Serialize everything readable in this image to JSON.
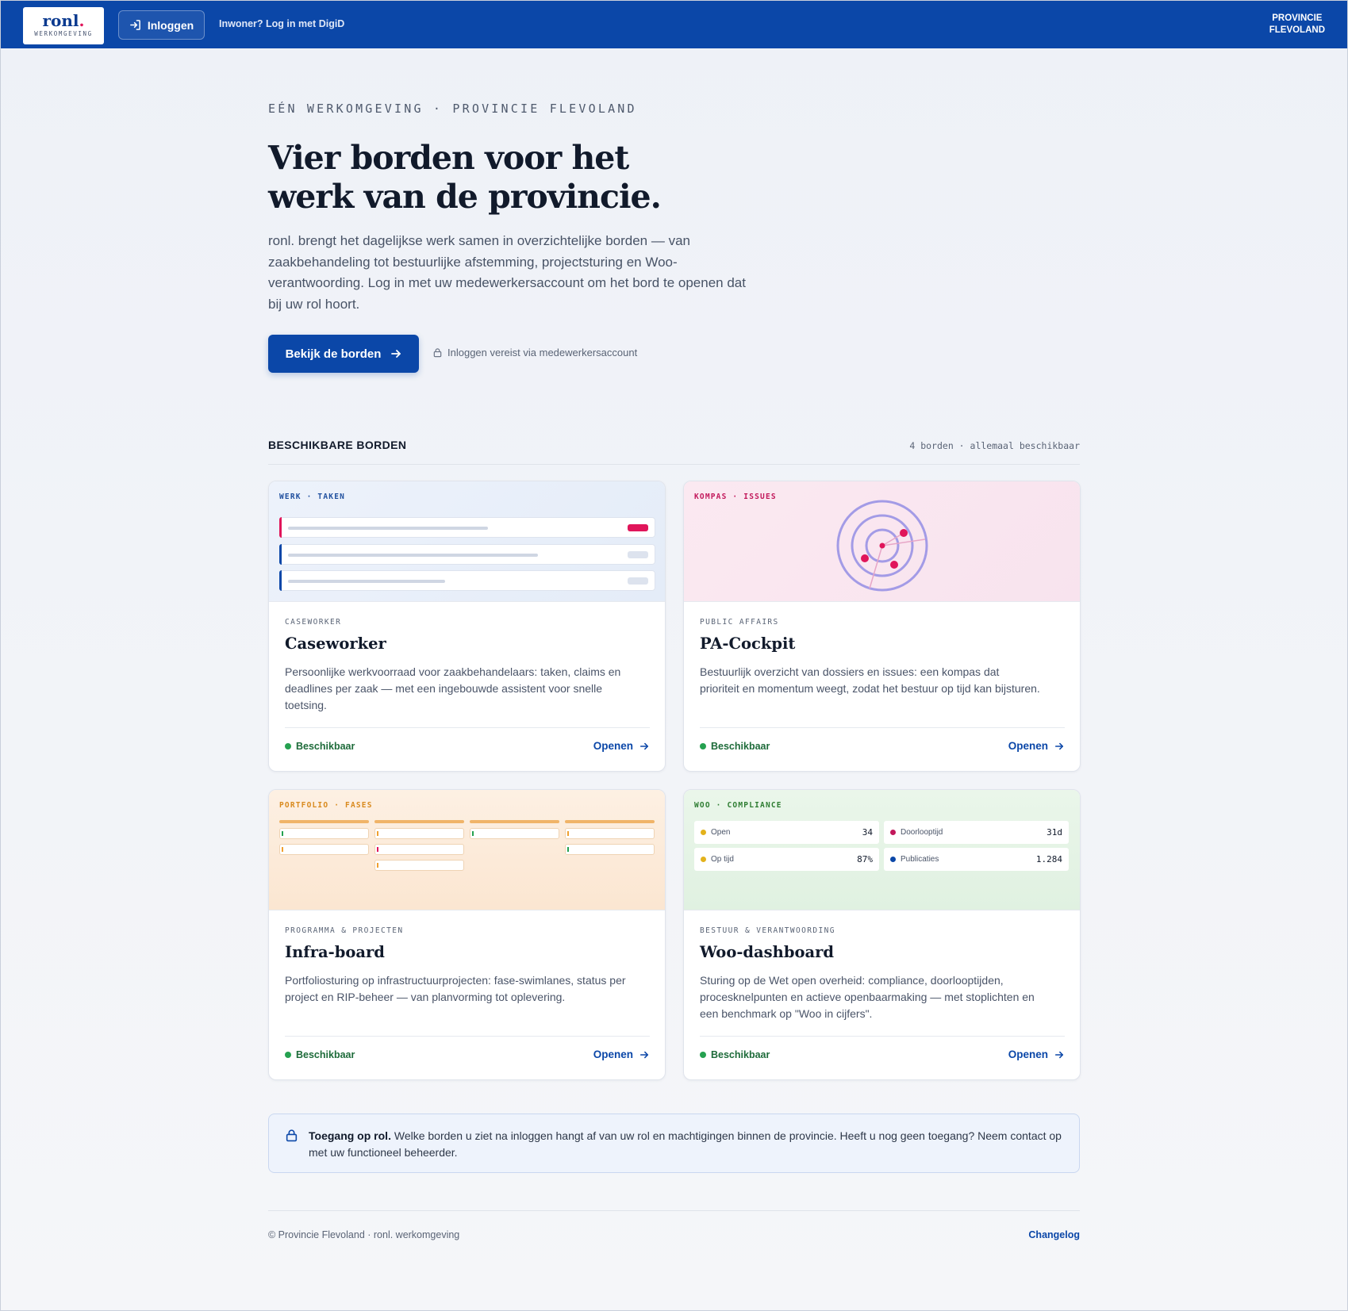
{
  "header": {
    "logo_word": "ronl",
    "logo_dot": ".",
    "logo_sub": "WERKOMGEVING",
    "login_label": "Inloggen",
    "digid_label": "Inwoner? Log in met DigiD",
    "province_line1": "PROVINCIE",
    "province_line2": "FLEVOLAND"
  },
  "hero": {
    "eyebrow": "EÉN WERKOMGEVING · PROVINCIE FLEVOLAND",
    "title_line1": "Vier borden voor het",
    "title_line2": "werk van de provincie.",
    "intro": "ronl. brengt het dagelijkse werk samen in overzichtelijke borden — van zaakbehandeling tot bestuurlijke afstemming, projectsturing en Woo-verantwoording. Log in met uw medewerkersaccount om het bord te openen dat bij uw rol hoort.",
    "cta_label": "Bekijk de borden",
    "lock_note": "Inloggen vereist via medewerkersaccount"
  },
  "section": {
    "title": "BESCHIKBARE BORDEN",
    "meta": "4 borden · allemaal beschikbaar"
  },
  "cards": [
    {
      "tag": "WERK · TAKEN",
      "category": "CASEWORKER",
      "title": "Caseworker",
      "description": "Persoonlijke werkvoorraad voor zaakbehandelaars: taken, claims en deadlines per zaak — met een ingebouwde assistent voor snelle toetsing.",
      "status": "Beschikbaar",
      "open_label": "Openen"
    },
    {
      "tag": "KOMPAS · ISSUES",
      "category": "PUBLIC AFFAIRS",
      "title": "PA-Cockpit",
      "description": "Bestuurlijk overzicht van dossiers en issues: een kompas dat prioriteit en momentum weegt, zodat het bestuur op tijd kan bijsturen.",
      "status": "Beschikbaar",
      "open_label": "Openen"
    },
    {
      "tag": "PORTFOLIO · FASES",
      "category": "PROGRAMMA & PROJECTEN",
      "title": "Infra-board",
      "description": "Portfoliosturing op infrastructuurprojecten: fase-swimlanes, status per project en RIP-beheer — van planvorming tot oplevering.",
      "status": "Beschikbaar",
      "open_label": "Openen"
    },
    {
      "tag": "WOO · COMPLIANCE",
      "category": "BESTUUR & VERANTWOORDING",
      "title": "Woo-dashboard",
      "description": "Sturing op de Wet open overheid: compliance, doorlooptijden, procesknelpunten en actieve openbaarmaking — met stoplichten en een benchmark op \"Woo in cijfers\".",
      "status": "Beschikbaar",
      "open_label": "Openen",
      "kpis": [
        {
          "label": "Open",
          "value": "34",
          "color": "#e3b21c"
        },
        {
          "label": "Doorlooptijd",
          "value": "31d",
          "color": "#c2185b"
        },
        {
          "label": "Op tijd",
          "value": "87%",
          "color": "#e3b21c"
        },
        {
          "label": "Publicaties",
          "value": "1.284",
          "color": "#0b47a8"
        }
      ]
    }
  ],
  "access": {
    "lead": "Toegang op rol.",
    "text": " Welke borden u ziet na inloggen hangt af van uw rol en machtigingen binnen de provincie. Heeft u nog geen toegang? Neem contact op met uw functioneel beheerder."
  },
  "footer": {
    "copyright": "© Provincie Flevoland · ronl. werkomgeving",
    "changelog": "Changelog"
  },
  "colors": {
    "brand": "#0b47a8",
    "accent": "#e0155a",
    "available": "#25a150"
  }
}
